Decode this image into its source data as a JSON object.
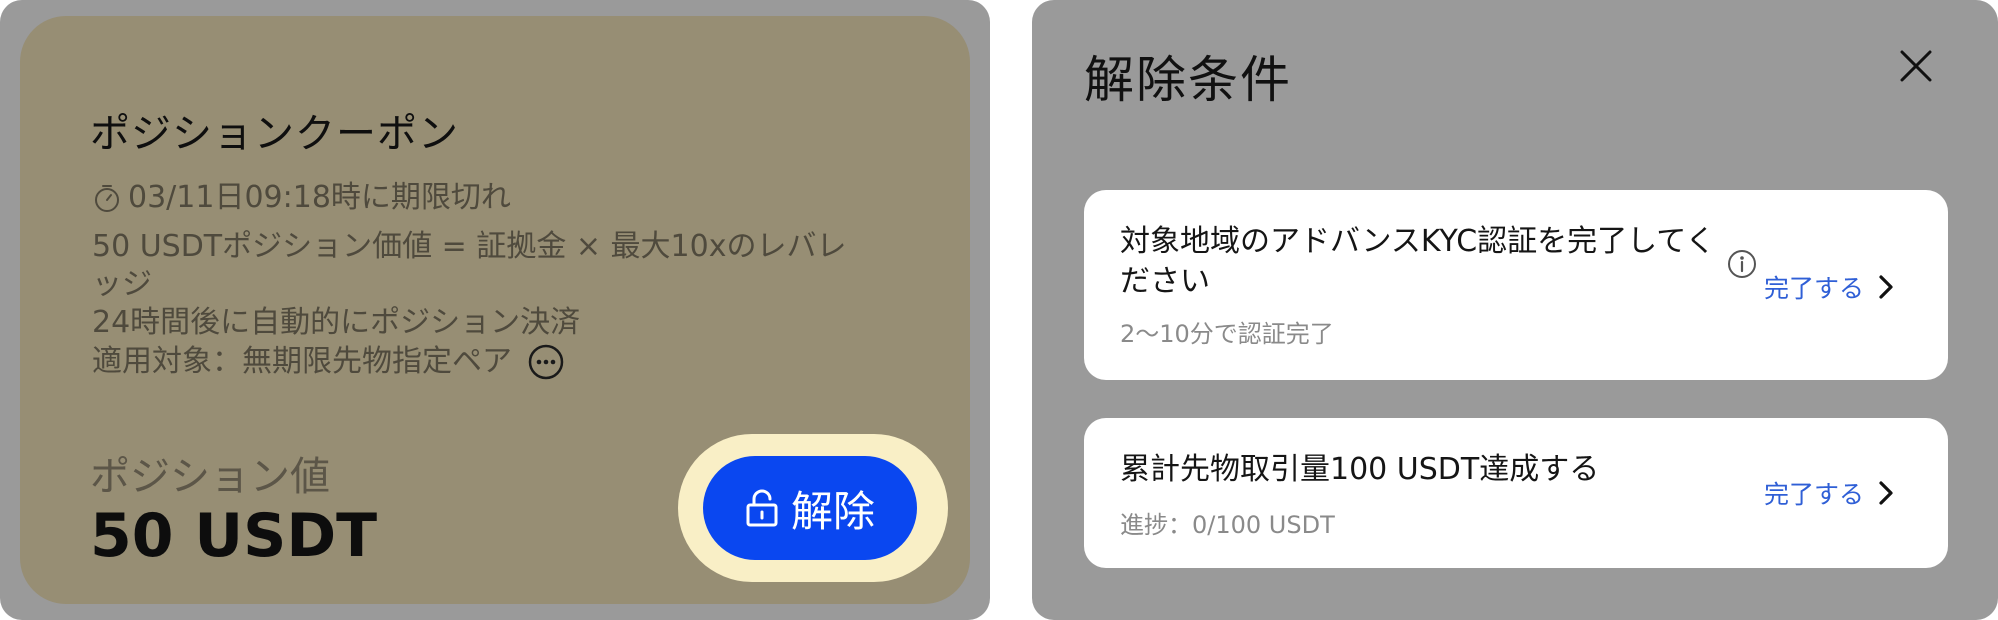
{
  "coupon": {
    "title": "ポジションクーポン",
    "expiry_text": "03/11日09:18時に期限切れ",
    "description_line1": "50 USDTポジション価値 = 証拠金 × 最大10xのレバレ",
    "description_line2": "ッジ",
    "description_line3": "24時間後に自動的にポジション決済",
    "applies_to": "適用対象：無期限先物指定ペア",
    "position_value_label": "ポジション値",
    "position_value": "50 USDT",
    "unlock_button_label": "解除"
  },
  "unlock_conditions": {
    "title": "解除条件",
    "conditions": [
      {
        "title": "対象地域のアドバンスKYC認証を完了してください",
        "subtitle": "2〜10分で認証完了",
        "action_label": "完了する"
      },
      {
        "title": "累計先物取引量100 USDT達成する",
        "subtitle": "進捗：0/100 USDT",
        "action_label": "完了する"
      }
    ]
  },
  "colors": {
    "panel_background": "#9a9a9a",
    "coupon_card_background": "#978e74",
    "unlock_button": "#0a47f0",
    "unlock_button_highlight": "#f9efc6",
    "link_blue": "#2f5fd6",
    "card_background": "#ffffff"
  },
  "icons": [
    "timer-icon",
    "more-icon",
    "lock-icon",
    "close-icon",
    "info-icon",
    "chevron-right-icon"
  ]
}
